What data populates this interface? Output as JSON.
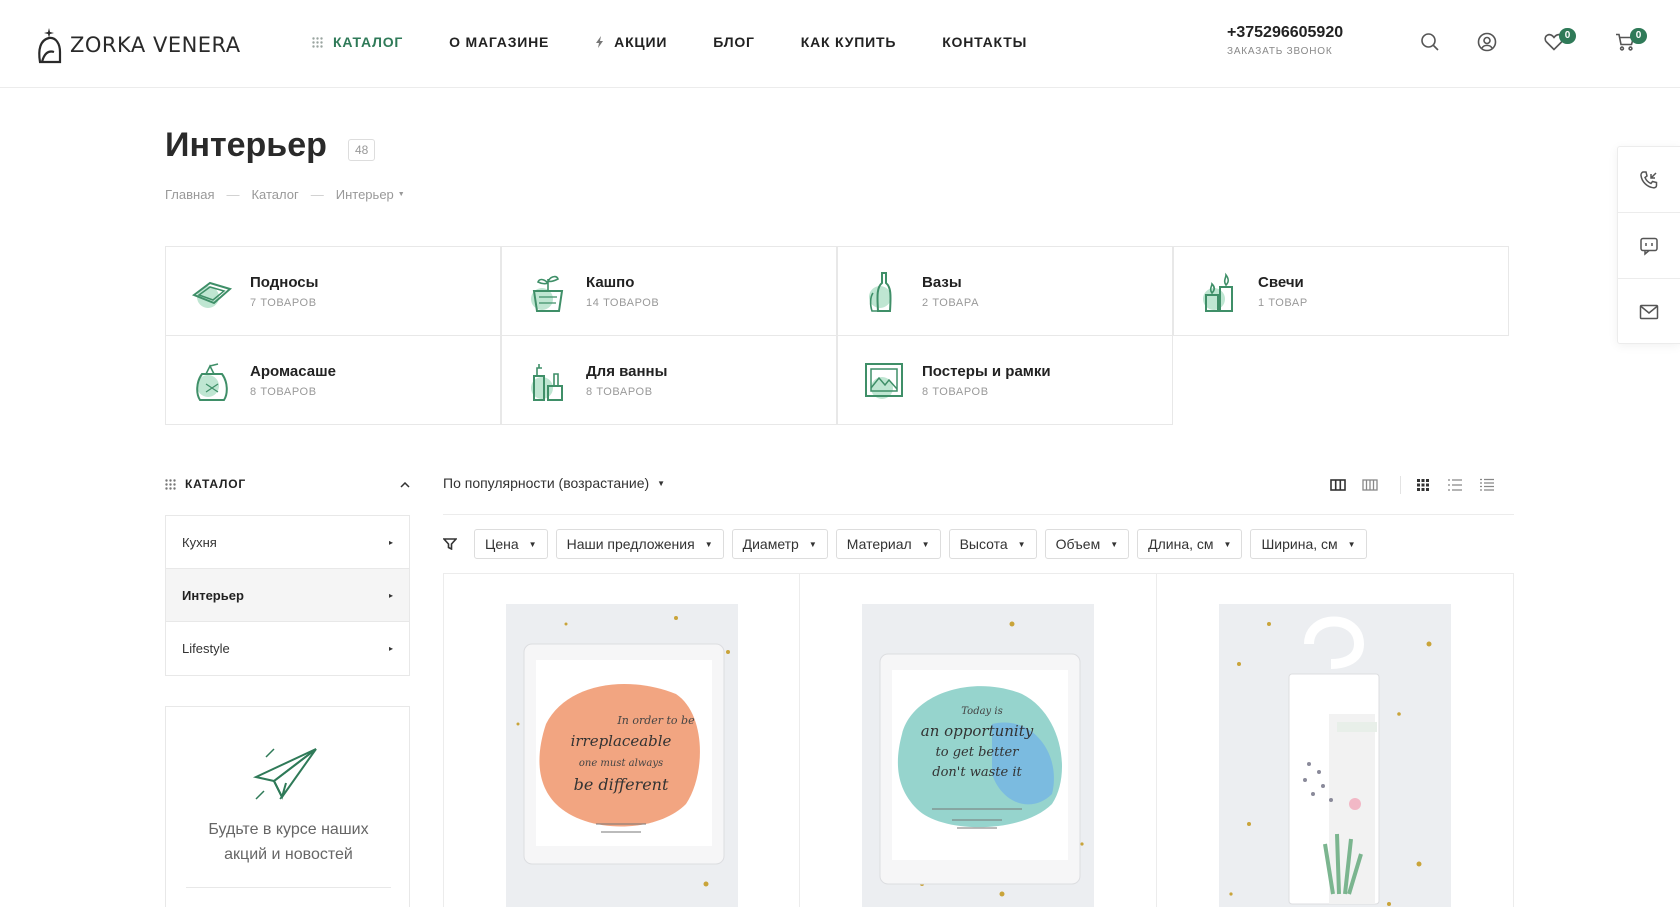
{
  "header": {
    "logo_text": "ZORKA VENERA",
    "nav": [
      {
        "label": "КАТАЛОГ",
        "icon": "grid-icon",
        "active": true
      },
      {
        "label": "О МАГАЗИНЕ"
      },
      {
        "label": "АКЦИИ",
        "icon": "lightning-icon"
      },
      {
        "label": "БЛОГ"
      },
      {
        "label": "КАК КУПИТЬ"
      },
      {
        "label": "КОНТАКТЫ"
      }
    ],
    "phone": "+375296605920",
    "callback": "ЗАКАЗАТЬ ЗВОНОК",
    "wishlist_count": "0",
    "cart_count": "0",
    "icons": [
      "search-icon",
      "user-icon",
      "heart-icon",
      "cart-icon"
    ]
  },
  "page": {
    "title": "Интерьер",
    "count": "48",
    "breadcrumbs": [
      "Главная",
      "Каталог",
      "Интерьер"
    ]
  },
  "categories": [
    {
      "name": "Подносы",
      "count": "7 ТОВАРОВ",
      "icon": "tray-icon"
    },
    {
      "name": "Кашпо",
      "count": "14 ТОВАРОВ",
      "icon": "planter-icon"
    },
    {
      "name": "Вазы",
      "count": "2 ТОВАРА",
      "icon": "vase-icon"
    },
    {
      "name": "Свечи",
      "count": "1 ТОВАР",
      "icon": "candle-icon"
    },
    {
      "name": "Аромасаше",
      "count": "8 ТОВАРОВ",
      "icon": "sachet-icon"
    },
    {
      "name": "Для ванны",
      "count": "8 ТОВАРОВ",
      "icon": "bath-icon"
    },
    {
      "name": "Постеры и рамки",
      "count": "8 ТОВАРОВ",
      "icon": "poster-icon"
    }
  ],
  "sidebar": {
    "title": "КАТАЛОГ",
    "items": [
      {
        "label": "Кухня",
        "active": false
      },
      {
        "label": "Интерьер",
        "active": true
      },
      {
        "label": "Lifestyle",
        "active": false
      }
    ],
    "subscribe_text_1": "Будьте в курсе наших",
    "subscribe_text_2": "акций и новостей"
  },
  "catalog": {
    "sort_label": "По популярности (возрастание)",
    "filters": [
      "Цена",
      "Наши предложения",
      "Диаметр",
      "Материал",
      "Высота",
      "Объем",
      "Длина, см",
      "Ширина, см"
    ]
  },
  "products": [
    {
      "image": "orange-watercolor-sachet",
      "card_lines": [
        "In order to be",
        "irreplaceable",
        "one must always",
        "be different"
      ]
    },
    {
      "image": "blue-green-watercolor-sachet",
      "card_lines": [
        "Today is",
        "an opportunity",
        "to get better",
        "don't waste it"
      ]
    },
    {
      "image": "hanging-aroma-sachet",
      "card_lines": []
    }
  ],
  "colors": {
    "accent": "#2f7a58",
    "icon_green": "#3f8f68",
    "mint": "#bfe6d2"
  }
}
